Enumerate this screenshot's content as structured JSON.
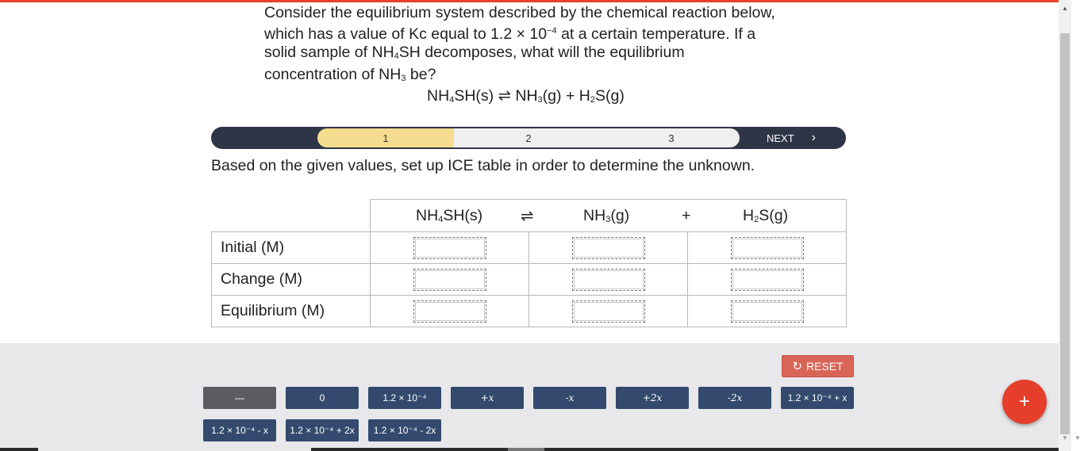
{
  "question": {
    "line1": "Consider the equilibrium system described by the chemical reaction below,",
    "line2_pre": "which has a value of Kc equal to 1.2 × 10",
    "line2_exp": "−4",
    "line2_post": " at a certain temperature. If a",
    "line3_pre": "solid sample of NH",
    "line3_sub": "4",
    "line3_post": "SH decomposes, what will the equilibrium",
    "line4_pre": "concentration of NH",
    "line4_sub": "3",
    "line4_post": " be?"
  },
  "equation": {
    "reactant": "NH4SH(s)",
    "arrow": "⇌",
    "product1": "NH3(g)",
    "plus": "+",
    "product2": "H2S(g)"
  },
  "stepper": {
    "steps": [
      "1",
      "2",
      "3"
    ],
    "active_step": "1",
    "next_label": "NEXT",
    "next_icon": "›"
  },
  "instruction": "Based on the given values, set up ICE table in order to determine the unknown.",
  "ice_table": {
    "headers": {
      "reactant": "NH4SH(s)",
      "arrow": "⇌",
      "product1": "NH3(g)",
      "plus": "+",
      "product2": "H2S(g)"
    },
    "rows": [
      "Initial (M)",
      "Change (M)",
      "Equilibrium (M)"
    ]
  },
  "tray": {
    "reset_label": "RESET",
    "reset_icon": "refresh-icon",
    "tiles": [
      "—",
      "0",
      "1.2 × 10⁻⁴",
      "+x",
      "-x",
      "+2x",
      "-2x",
      "1.2 × 10⁻⁴ + x",
      "1.2 × 10⁻⁴ - x",
      "1.2 × 10⁻⁴ + 2x",
      "1.2 × 10⁻⁴ - 2x"
    ]
  },
  "fab": {
    "label": "+"
  },
  "colors": {
    "accent": "#e8412c",
    "stepper_bg": "#2e3547",
    "active_step": "#f6dc8f",
    "tile_bg": "#334a6e",
    "reset_bg": "#d96557",
    "fab_bg": "#e53e2b"
  }
}
